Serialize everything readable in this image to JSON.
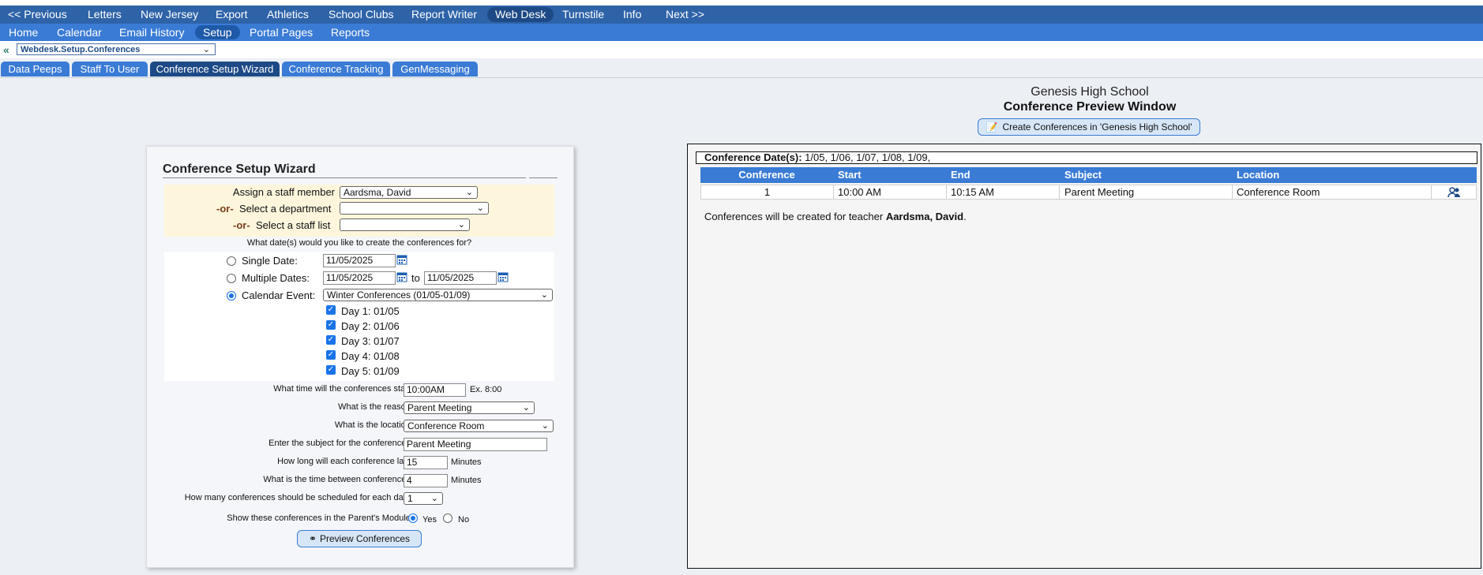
{
  "nav_top": [
    "<< Previous",
    "Letters",
    "New Jersey",
    "Export",
    "Athletics",
    "School Clubs",
    "Report Writer",
    "Web Desk",
    "Turnstile",
    "Info",
    "Next >>"
  ],
  "nav_sub": [
    "Home",
    "Calendar",
    "Email History",
    "Setup",
    "Portal Pages",
    "Reports"
  ],
  "breadcrumb": {
    "select_value": "Webdesk.Setup.Conferences"
  },
  "tabs": [
    "Data Peeps",
    "Staff To User",
    "Conference Setup Wizard",
    "Conference Tracking",
    "GenMessaging"
  ],
  "wizard": {
    "title": "Conference Setup Wizard",
    "assign_label": "Assign a staff member",
    "assign_value": "Aardsma, David",
    "or_label": "-or-",
    "dept_label": "Select a department",
    "dept_value": "",
    "stafflist_label": "Select a staff list",
    "stafflist_value": "",
    "dates_question": "What date(s) would you like to create the conferences for?",
    "single_label": "Single Date:",
    "single_value": "11/05/2025",
    "multiple_label": "Multiple Dates:",
    "multiple_from": "11/05/2025",
    "to_label": "to",
    "multiple_to": "11/05/2025",
    "calendar_label": "Calendar Event:",
    "calendar_value": "Winter Conferences (01/05-01/09)",
    "days": [
      "Day 1: 01/05",
      "Day 2: 01/06",
      "Day 3: 01/07",
      "Day 4: 01/08",
      "Day 5: 01/09"
    ],
    "start_q": "What time will the conferences start?",
    "start_value": "10:00AM",
    "start_hint": "Ex. 8:00",
    "reason_q": "What is the reason?",
    "reason_value": "Parent Meeting",
    "location_q": "What is the location?",
    "location_value": "Conference Room",
    "subject_q": "Enter the subject for the conferences?",
    "subject_value": "Parent Meeting",
    "length_q": "How long will each conference last?",
    "length_value": "15",
    "between_q": "What is the time between conferences?",
    "between_value": "4",
    "minutes": "Minutes",
    "howmany_q": "How many conferences should be scheduled for each date?",
    "howmany_value": "1",
    "parent_q": "Show these conferences in the Parent's Module?",
    "yes": "Yes",
    "no": "No",
    "preview_button": "Preview Conferences"
  },
  "preview": {
    "school": "Genesis High School",
    "title": "Conference Preview Window",
    "create_button": "Create Conferences in 'Genesis High School'",
    "dates_label": "Conference Date(s):",
    "dates_value": "1/05, 1/06, 1/07, 1/08, 1/09,",
    "columns": [
      "Conference",
      "Start",
      "End",
      "Subject",
      "Location"
    ],
    "row": {
      "conference": "1",
      "start": "10:00 AM",
      "end": "10:15 AM",
      "subject": "Parent Meeting",
      "location": "Conference Room"
    },
    "note_prefix": "Conferences will be created for teacher",
    "note_teacher": "Aardsma, David",
    "note_suffix": "."
  }
}
